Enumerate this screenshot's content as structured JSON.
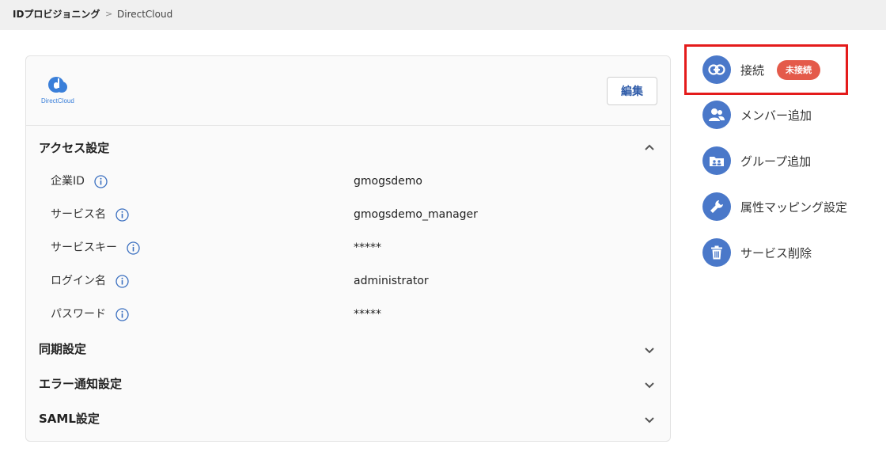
{
  "breadcrumb": {
    "root": "IDプロビジョニング",
    "separator": ">",
    "current": "DirectCloud"
  },
  "card": {
    "logo_text": "DirectCloud",
    "edit_label": "編集",
    "sections": [
      {
        "title": "アクセス設定",
        "expanded": true
      },
      {
        "title": "同期設定",
        "expanded": false
      },
      {
        "title": "エラー通知設定",
        "expanded": false
      },
      {
        "title": "SAML設定",
        "expanded": false
      }
    ],
    "access_rows": [
      {
        "label": "企業ID",
        "value": "gmogsdemo"
      },
      {
        "label": "サービス名",
        "value": "gmogsdemo_manager"
      },
      {
        "label": "サービスキー",
        "value": "*****"
      },
      {
        "label": "ログイン名",
        "value": "administrator"
      },
      {
        "label": "パスワード",
        "value": "*****"
      }
    ]
  },
  "sidebar": {
    "items": [
      {
        "label": "接続",
        "icon": "link-icon",
        "badge": "未接続"
      },
      {
        "label": "メンバー追加",
        "icon": "users-icon"
      },
      {
        "label": "グループ追加",
        "icon": "group-folder-icon"
      },
      {
        "label": "属性マッピング設定",
        "icon": "wrench-icon"
      },
      {
        "label": "サービス削除",
        "icon": "trash-icon"
      }
    ]
  },
  "colors": {
    "accent": "#4a78c9",
    "badge": "#e45a4a",
    "highlight": "#e41b1b",
    "edit_text": "#2d5aa8"
  }
}
